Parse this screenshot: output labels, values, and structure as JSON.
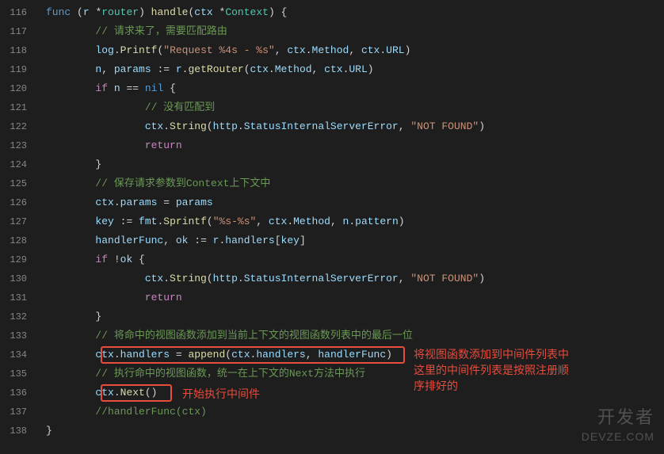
{
  "lineStart": 116,
  "lineEnd": 138,
  "tokens": {
    "l116": [
      {
        "t": "func ",
        "c": "func-kw"
      },
      {
        "t": "(",
        "c": "paren"
      },
      {
        "t": "r ",
        "c": "ident"
      },
      {
        "t": "*",
        "c": "op"
      },
      {
        "t": "router",
        "c": "type"
      },
      {
        "t": ") ",
        "c": "paren"
      },
      {
        "t": "handle",
        "c": "func"
      },
      {
        "t": "(",
        "c": "paren"
      },
      {
        "t": "ctx ",
        "c": "ident"
      },
      {
        "t": "*",
        "c": "op"
      },
      {
        "t": "Context",
        "c": "type"
      },
      {
        "t": ") {",
        "c": "paren"
      }
    ],
    "l117": [
      {
        "t": "        ",
        "c": "op"
      },
      {
        "t": "// 请求来了，需要匹配路由",
        "c": "comment"
      }
    ],
    "l118": [
      {
        "t": "        ",
        "c": "op"
      },
      {
        "t": "log",
        "c": "ident"
      },
      {
        "t": ".",
        "c": "punct"
      },
      {
        "t": "Printf",
        "c": "func"
      },
      {
        "t": "(",
        "c": "paren"
      },
      {
        "t": "\"Request %4s - %s\"",
        "c": "str"
      },
      {
        "t": ", ",
        "c": "punct"
      },
      {
        "t": "ctx",
        "c": "ident"
      },
      {
        "t": ".",
        "c": "punct"
      },
      {
        "t": "Method",
        "c": "ident"
      },
      {
        "t": ", ",
        "c": "punct"
      },
      {
        "t": "ctx",
        "c": "ident"
      },
      {
        "t": ".",
        "c": "punct"
      },
      {
        "t": "URL",
        "c": "ident"
      },
      {
        "t": ")",
        "c": "paren"
      }
    ],
    "l119": [
      {
        "t": "        ",
        "c": "op"
      },
      {
        "t": "n",
        "c": "ident"
      },
      {
        "t": ", ",
        "c": "punct"
      },
      {
        "t": "params ",
        "c": "ident"
      },
      {
        "t": ":= ",
        "c": "op"
      },
      {
        "t": "r",
        "c": "ident"
      },
      {
        "t": ".",
        "c": "punct"
      },
      {
        "t": "getRouter",
        "c": "func"
      },
      {
        "t": "(",
        "c": "paren"
      },
      {
        "t": "ctx",
        "c": "ident"
      },
      {
        "t": ".",
        "c": "punct"
      },
      {
        "t": "Method",
        "c": "ident"
      },
      {
        "t": ", ",
        "c": "punct"
      },
      {
        "t": "ctx",
        "c": "ident"
      },
      {
        "t": ".",
        "c": "punct"
      },
      {
        "t": "URL",
        "c": "ident"
      },
      {
        "t": ")",
        "c": "paren"
      }
    ],
    "l120": [
      {
        "t": "        ",
        "c": "op"
      },
      {
        "t": "if ",
        "c": "kw"
      },
      {
        "t": "n ",
        "c": "ident"
      },
      {
        "t": "== ",
        "c": "op"
      },
      {
        "t": "nil ",
        "c": "nil"
      },
      {
        "t": "{",
        "c": "paren"
      }
    ],
    "l121": [
      {
        "t": "                ",
        "c": "op"
      },
      {
        "t": "// 没有匹配到",
        "c": "comment"
      }
    ],
    "l122": [
      {
        "t": "                ",
        "c": "op"
      },
      {
        "t": "ctx",
        "c": "ident"
      },
      {
        "t": ".",
        "c": "punct"
      },
      {
        "t": "String",
        "c": "func"
      },
      {
        "t": "(",
        "c": "paren"
      },
      {
        "t": "http",
        "c": "ident"
      },
      {
        "t": ".",
        "c": "punct"
      },
      {
        "t": "StatusInternalServerError",
        "c": "ident"
      },
      {
        "t": ", ",
        "c": "punct"
      },
      {
        "t": "\"NOT FOUND\"",
        "c": "str"
      },
      {
        "t": ")",
        "c": "paren"
      }
    ],
    "l123": [
      {
        "t": "                ",
        "c": "op"
      },
      {
        "t": "return",
        "c": "kw"
      }
    ],
    "l124": [
      {
        "t": "        }",
        "c": "paren"
      }
    ],
    "l125": [
      {
        "t": "        ",
        "c": "op"
      },
      {
        "t": "// 保存请求参数到Context上下文中",
        "c": "comment"
      }
    ],
    "l126": [
      {
        "t": "        ",
        "c": "op"
      },
      {
        "t": "ctx",
        "c": "ident"
      },
      {
        "t": ".",
        "c": "punct"
      },
      {
        "t": "params ",
        "c": "ident"
      },
      {
        "t": "= ",
        "c": "op"
      },
      {
        "t": "params",
        "c": "ident"
      }
    ],
    "l127": [
      {
        "t": "        ",
        "c": "op"
      },
      {
        "t": "key ",
        "c": "ident"
      },
      {
        "t": ":= ",
        "c": "op"
      },
      {
        "t": "fmt",
        "c": "ident"
      },
      {
        "t": ".",
        "c": "punct"
      },
      {
        "t": "Sprintf",
        "c": "func"
      },
      {
        "t": "(",
        "c": "paren"
      },
      {
        "t": "\"%s-%s\"",
        "c": "str"
      },
      {
        "t": ", ",
        "c": "punct"
      },
      {
        "t": "ctx",
        "c": "ident"
      },
      {
        "t": ".",
        "c": "punct"
      },
      {
        "t": "Method",
        "c": "ident"
      },
      {
        "t": ", ",
        "c": "punct"
      },
      {
        "t": "n",
        "c": "ident"
      },
      {
        "t": ".",
        "c": "punct"
      },
      {
        "t": "pattern",
        "c": "ident"
      },
      {
        "t": ")",
        "c": "paren"
      }
    ],
    "l128": [
      {
        "t": "        ",
        "c": "op"
      },
      {
        "t": "handlerFunc",
        "c": "ident"
      },
      {
        "t": ", ",
        "c": "punct"
      },
      {
        "t": "ok ",
        "c": "ident"
      },
      {
        "t": ":= ",
        "c": "op"
      },
      {
        "t": "r",
        "c": "ident"
      },
      {
        "t": ".",
        "c": "punct"
      },
      {
        "t": "handlers",
        "c": "ident"
      },
      {
        "t": "[",
        "c": "paren"
      },
      {
        "t": "key",
        "c": "ident"
      },
      {
        "t": "]",
        "c": "paren"
      }
    ],
    "l129": [
      {
        "t": "        ",
        "c": "op"
      },
      {
        "t": "if ",
        "c": "kw"
      },
      {
        "t": "!",
        "c": "op"
      },
      {
        "t": "ok ",
        "c": "ident"
      },
      {
        "t": "{",
        "c": "paren"
      }
    ],
    "l130": [
      {
        "t": "                ",
        "c": "op"
      },
      {
        "t": "ctx",
        "c": "ident"
      },
      {
        "t": ".",
        "c": "punct"
      },
      {
        "t": "String",
        "c": "func"
      },
      {
        "t": "(",
        "c": "paren"
      },
      {
        "t": "http",
        "c": "ident"
      },
      {
        "t": ".",
        "c": "punct"
      },
      {
        "t": "StatusInternalServerError",
        "c": "ident"
      },
      {
        "t": ", ",
        "c": "punct"
      },
      {
        "t": "\"NOT FOUND\"",
        "c": "str"
      },
      {
        "t": ")",
        "c": "paren"
      }
    ],
    "l131": [
      {
        "t": "                ",
        "c": "op"
      },
      {
        "t": "return",
        "c": "kw"
      }
    ],
    "l132": [
      {
        "t": "        }",
        "c": "paren"
      }
    ],
    "l133": [
      {
        "t": "        ",
        "c": "op"
      },
      {
        "t": "// 将命中的视图函数添加到当前上下文的视图函数列表中的最后一位",
        "c": "comment"
      }
    ],
    "l134": [
      {
        "t": "        ",
        "c": "op"
      },
      {
        "t": "ctx",
        "c": "ident"
      },
      {
        "t": ".",
        "c": "punct"
      },
      {
        "t": "handlers ",
        "c": "ident"
      },
      {
        "t": "= ",
        "c": "op"
      },
      {
        "t": "append",
        "c": "func"
      },
      {
        "t": "(",
        "c": "paren"
      },
      {
        "t": "ctx",
        "c": "ident"
      },
      {
        "t": ".",
        "c": "punct"
      },
      {
        "t": "handlers",
        "c": "ident"
      },
      {
        "t": ", ",
        "c": "punct"
      },
      {
        "t": "handlerFunc",
        "c": "ident"
      },
      {
        "t": ")",
        "c": "paren"
      }
    ],
    "l135": [
      {
        "t": "        ",
        "c": "op"
      },
      {
        "t": "// 执行命中的视图函数，统一在上下文的Next方法中执行",
        "c": "comment"
      }
    ],
    "l136": [
      {
        "t": "        ",
        "c": "op"
      },
      {
        "t": "ctx",
        "c": "ident"
      },
      {
        "t": ".",
        "c": "punct"
      },
      {
        "t": "Next",
        "c": "func"
      },
      {
        "t": "()",
        "c": "paren"
      }
    ],
    "l137": [
      {
        "t": "        ",
        "c": "op"
      },
      {
        "t": "//handlerFunc(ctx)",
        "c": "comment"
      }
    ],
    "l138": [
      {
        "t": "}",
        "c": "paren"
      }
    ]
  },
  "annotations": {
    "a1": "将视图函数添加到中间件列表中\n这里的中间件列表是按照注册顺\n序排好的",
    "a2": "开始执行中间件"
  },
  "watermark": {
    "main": "开发者",
    "sub": "DEVZE.COM"
  }
}
